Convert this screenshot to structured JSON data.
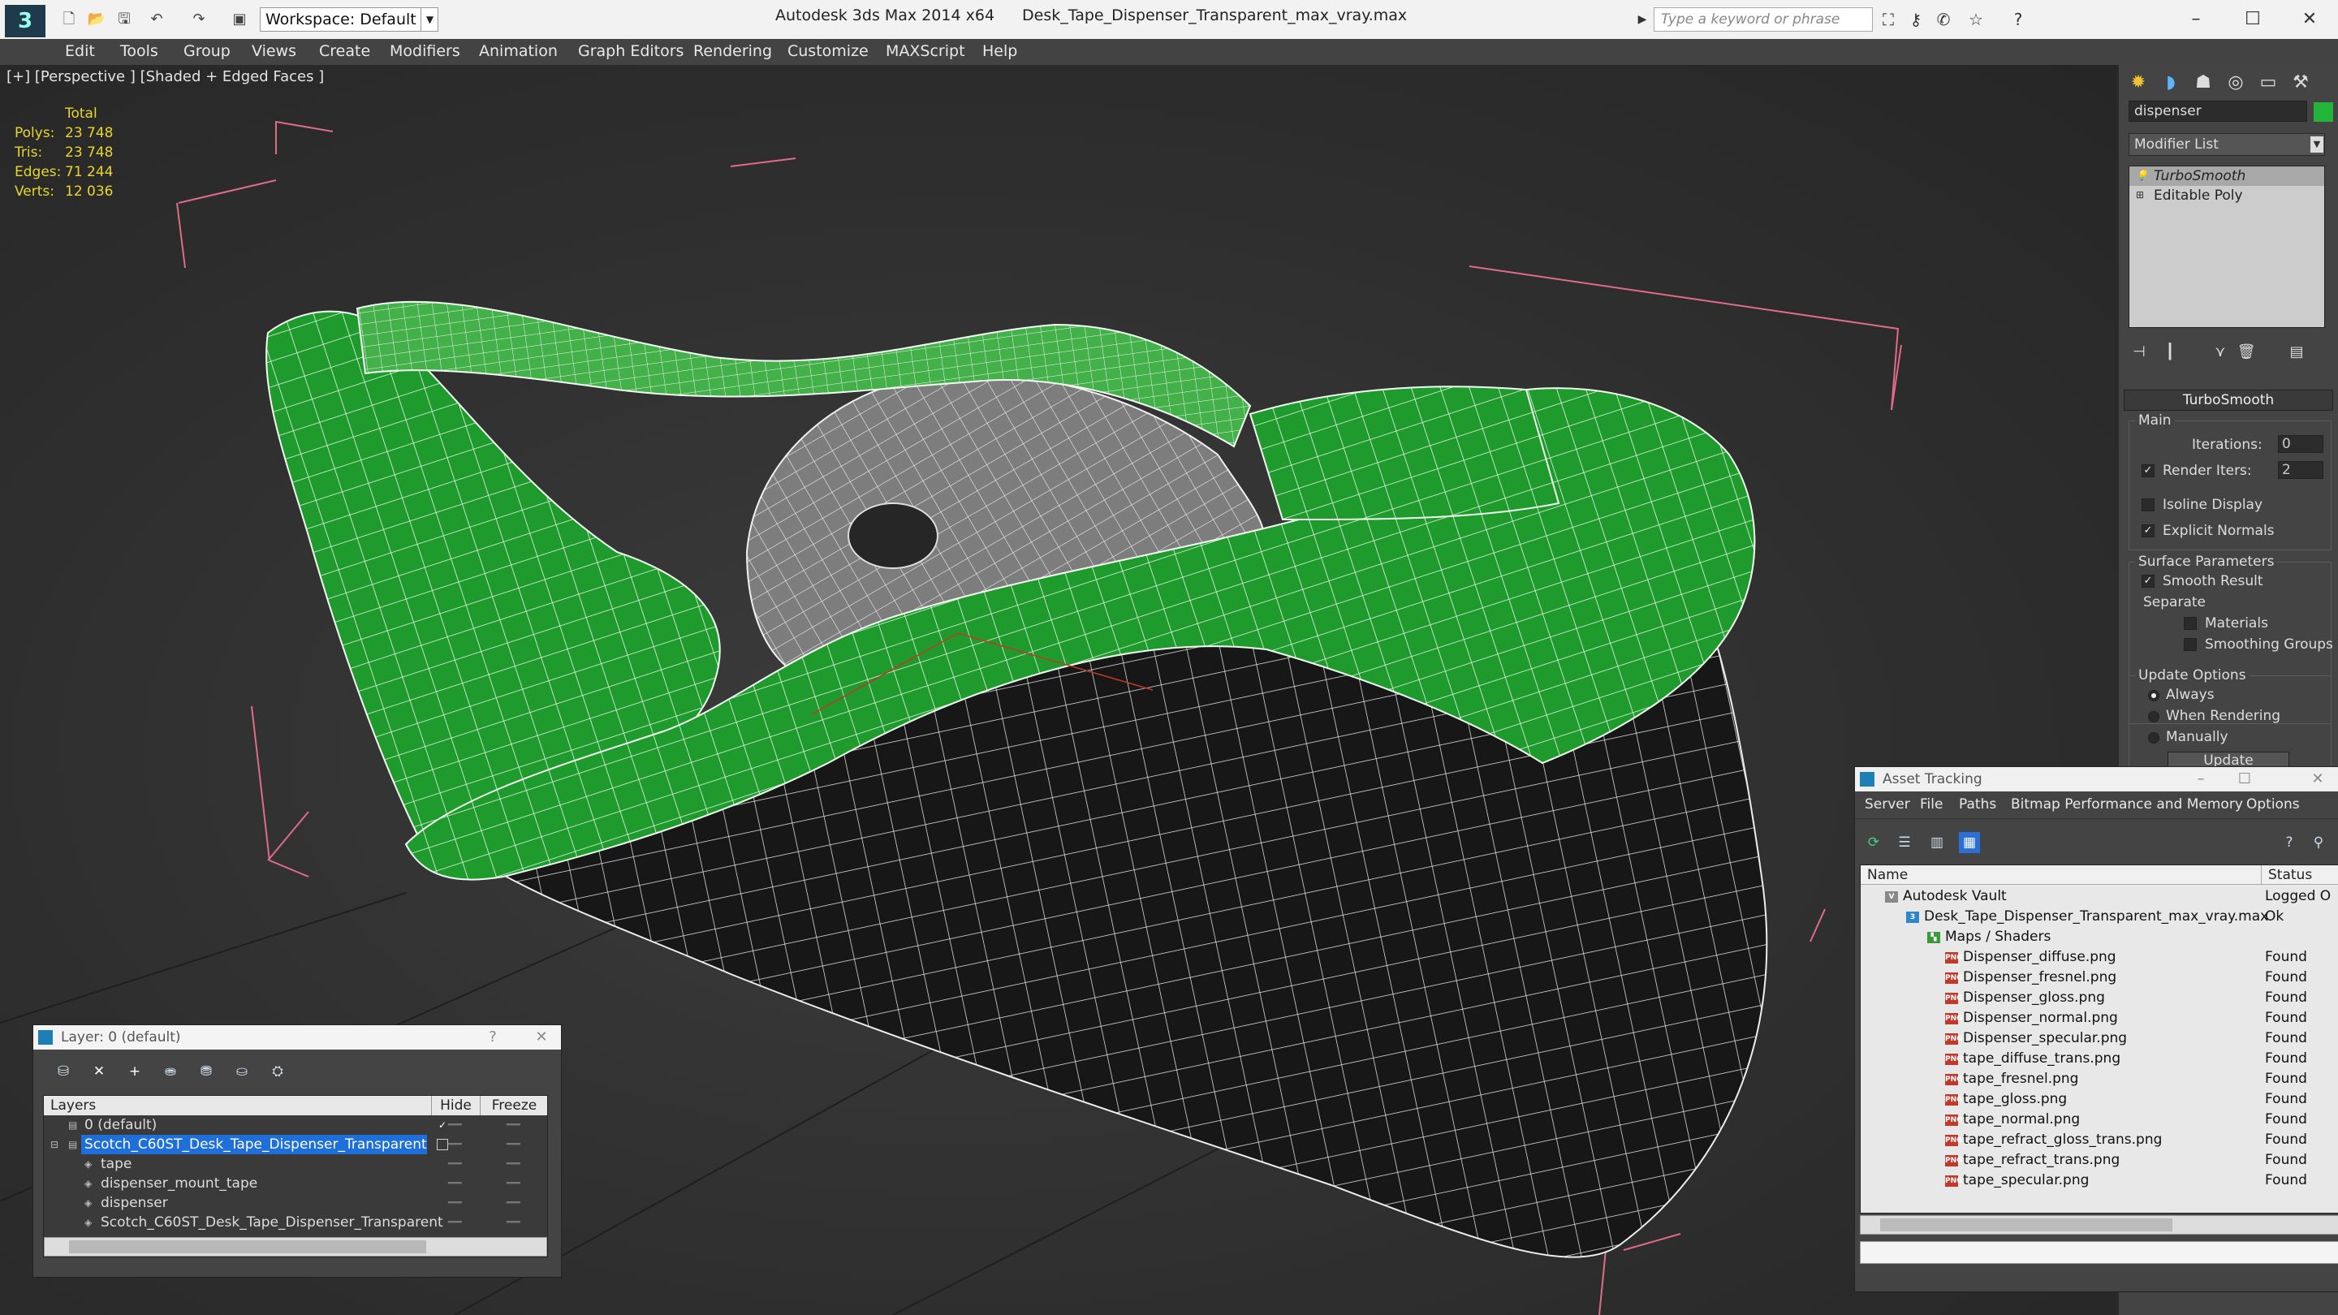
{
  "titlebar": {
    "workspace": "Workspace: Default",
    "app_title": "Autodesk 3ds Max 2014 x64",
    "file_name": "Desk_Tape_Dispenser_Transparent_max_vray.max",
    "search_placeholder": "Type a keyword or phrase"
  },
  "menu": [
    "Edit",
    "Tools",
    "Group",
    "Views",
    "Create",
    "Modifiers",
    "Animation",
    "Graph Editors",
    "Rendering",
    "Customize",
    "MAXScript",
    "Help"
  ],
  "viewport": {
    "label": "[+] [Perspective ] [Shaded + Edged Faces ]",
    "stats": {
      "header": "Total",
      "rows": [
        {
          "label": "Polys:",
          "value": "23 748"
        },
        {
          "label": "Tris:",
          "value": "23 748"
        },
        {
          "label": "Edges:",
          "value": "71 244"
        },
        {
          "label": "Verts:",
          "value": "12 036"
        }
      ]
    }
  },
  "command_panel": {
    "object_name": "dispenser",
    "object_color": "#22b53a",
    "modifier_list": "Modifier List",
    "stack": [
      "TurboSmooth",
      "Editable Poly"
    ],
    "rollout_title": "TurboSmooth",
    "main_group": "Main",
    "iterations_label": "Iterations:",
    "iterations_value": "0",
    "render_iters_label": "Render Iters:",
    "render_iters_value": "2",
    "isoline_label": "Isoline Display",
    "isoline_checked": false,
    "explicit_label": "Explicit Normals",
    "explicit_checked": true,
    "surface_group": "Surface Parameters",
    "smooth_result_label": "Smooth Result",
    "smooth_result_checked": true,
    "separate_label": "Separate",
    "materials_label": "Materials",
    "smoothing_groups_label": "Smoothing Groups",
    "update_group": "Update Options",
    "always_label": "Always",
    "when_rendering_label": "When Rendering",
    "manually_label": "Manually",
    "update_button": "Update"
  },
  "layer_panel": {
    "title": "Layer: 0 (default)",
    "col_layers": "Layers",
    "col_hide": "Hide",
    "col_freeze": "Freeze",
    "rows": [
      {
        "name": "0 (default)",
        "level": 0
      },
      {
        "name": "Scotch_C60ST_Desk_Tape_Dispenser_Transparent",
        "level": 0,
        "selected": true
      },
      {
        "name": "tape",
        "level": 1
      },
      {
        "name": "dispenser_mount_tape",
        "level": 1
      },
      {
        "name": "dispenser",
        "level": 1
      },
      {
        "name": "Scotch_C60ST_Desk_Tape_Dispenser_Transparent",
        "level": 1
      }
    ]
  },
  "asset_panel": {
    "title": "Asset Tracking",
    "menu": [
      "Server",
      "File",
      "Paths",
      "Bitmap Performance and Memory",
      "Options"
    ],
    "col_name": "Name",
    "col_status": "Status",
    "rows": [
      {
        "name": "Autodesk Vault",
        "status": "Logged O",
        "level": 0,
        "icon": "vault"
      },
      {
        "name": "Desk_Tape_Dispenser_Transparent_max_vray.max",
        "status": "Ok",
        "level": 1,
        "icon": "max"
      },
      {
        "name": "Maps / Shaders",
        "status": "",
        "level": 2,
        "icon": "folder"
      },
      {
        "name": "Dispenser_diffuse.png",
        "status": "Found",
        "level": 3,
        "icon": "png"
      },
      {
        "name": "Dispenser_fresnel.png",
        "status": "Found",
        "level": 3,
        "icon": "png"
      },
      {
        "name": "Dispenser_gloss.png",
        "status": "Found",
        "level": 3,
        "icon": "png"
      },
      {
        "name": "Dispenser_normal.png",
        "status": "Found",
        "level": 3,
        "icon": "png"
      },
      {
        "name": "Dispenser_specular.png",
        "status": "Found",
        "level": 3,
        "icon": "png"
      },
      {
        "name": "tape_diffuse_trans.png",
        "status": "Found",
        "level": 3,
        "icon": "png"
      },
      {
        "name": "tape_fresnel.png",
        "status": "Found",
        "level": 3,
        "icon": "png"
      },
      {
        "name": "tape_gloss.png",
        "status": "Found",
        "level": 3,
        "icon": "png"
      },
      {
        "name": "tape_normal.png",
        "status": "Found",
        "level": 3,
        "icon": "png"
      },
      {
        "name": "tape_refract_gloss_trans.png",
        "status": "Found",
        "level": 3,
        "icon": "png"
      },
      {
        "name": "tape_refract_trans.png",
        "status": "Found",
        "level": 3,
        "icon": "png"
      },
      {
        "name": "tape_specular.png",
        "status": "Found",
        "level": 3,
        "icon": "png"
      }
    ]
  }
}
